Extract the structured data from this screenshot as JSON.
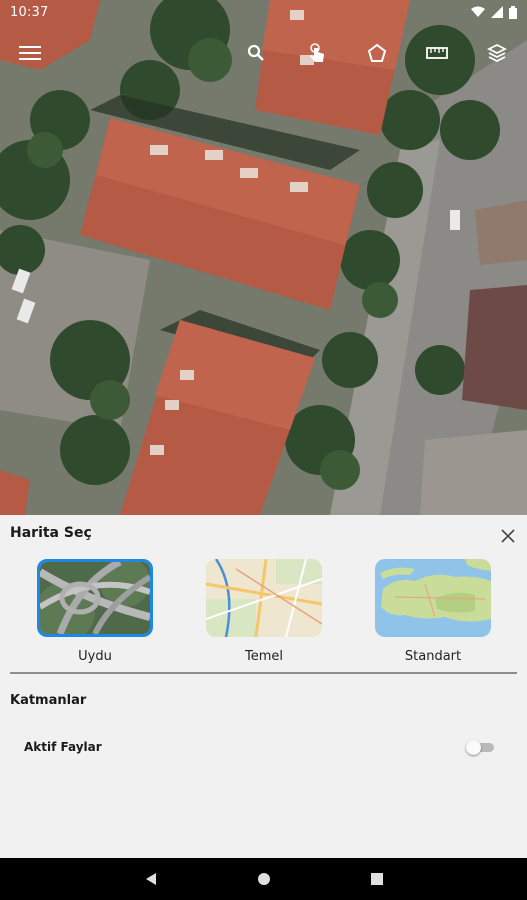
{
  "status_bar": {
    "time": "10:37",
    "icons": [
      "wifi-icon",
      "signal-icon",
      "battery-icon"
    ]
  },
  "map_toolbar": {
    "buttons": [
      "menu-icon",
      "search-icon",
      "touch-icon",
      "polygon-icon",
      "ruler-icon",
      "layers-icon"
    ]
  },
  "sheet": {
    "title": "Harita Seç",
    "options": [
      {
        "label": "Uydu",
        "selected": true
      },
      {
        "label": "Temel",
        "selected": false
      },
      {
        "label": "Standart",
        "selected": false
      }
    ],
    "layers_title": "Katmanlar",
    "layers": [
      {
        "label": "Aktif Faylar",
        "enabled": false
      }
    ]
  },
  "colors": {
    "accent": "#1e88e5",
    "sheet_bg": "#f1f1f1",
    "roof": "#b45a45"
  },
  "nav_bar": {
    "buttons": [
      "back-icon",
      "home-icon",
      "recents-icon"
    ]
  }
}
